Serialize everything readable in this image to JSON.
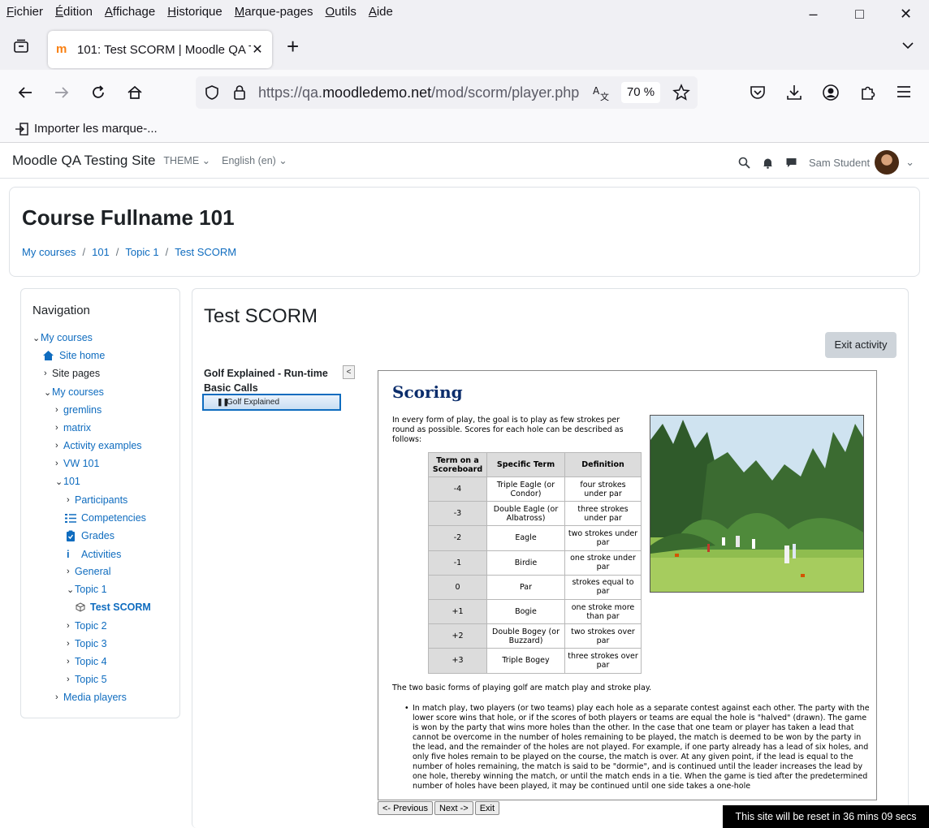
{
  "browser": {
    "menu": [
      {
        "key": "F",
        "rest": "ichier"
      },
      {
        "key": "É",
        "rest": "dition"
      },
      {
        "key": "A",
        "rest": "ffichage"
      },
      {
        "key": "H",
        "rest": "istorique"
      },
      {
        "key": "M",
        "rest": "arque-pages"
      },
      {
        "key": "O",
        "rest": "utils"
      },
      {
        "key": "A",
        "rest": "ide"
      }
    ],
    "tab_title": "101: Test SCORM | Moodle QA Testing Site",
    "url_prefix": "https://qa.",
    "url_domain": "moodledemo.net",
    "url_path": "/mod/scorm/player.php",
    "zoom": "70 %",
    "bookmark_import": "Importer les marque-..."
  },
  "moodle": {
    "site_name": "Moodle QA Testing Site",
    "theme_menu": "THEME",
    "lang_menu": "English (en)",
    "user_name": "Sam Student",
    "course_title": "Course Fullname 101",
    "breadcrumb": [
      "My courses",
      "101",
      "Topic 1",
      "Test SCORM"
    ],
    "nav_title": "Navigation",
    "nav": {
      "my_courses_top": "My courses",
      "site_home": "Site home",
      "site_pages": "Site pages",
      "my_courses": "My courses",
      "gremlins": "gremlins",
      "matrix": "matrix",
      "activity_examples": "Activity examples",
      "vw101": "VW 101",
      "c101": "101",
      "participants": "Participants",
      "competencies": "Competencies",
      "grades": "Grades",
      "activities": "Activities",
      "general": "General",
      "topic1": "Topic 1",
      "test_scorm": "Test SCORM",
      "topic2": "Topic 2",
      "topic3": "Topic 3",
      "topic4": "Topic 4",
      "topic5": "Topic 5",
      "media_players": "Media players"
    },
    "page_heading": "Test SCORM",
    "exit_activity": "Exit activity",
    "toc_title": "Golf Explained - Run-time Basic Calls",
    "toc_toggle": "<",
    "toc_item": "Golf Explained",
    "reset_notice": "This site will be reset in 36 mins 09 secs"
  },
  "scorm": {
    "heading": "Scoring",
    "intro": "In every form of play, the goal is to play as few strokes per round as possible. Scores for each hole can be described as follows:",
    "table_headers": [
      "Term on a Scoreboard",
      "Specific Term",
      "Definition"
    ],
    "table_rows": [
      [
        "-4",
        "Triple Eagle (or Condor)",
        "four strokes under par"
      ],
      [
        "-3",
        "Double Eagle (or Albatross)",
        "three strokes under par"
      ],
      [
        "-2",
        "Eagle",
        "two strokes under par"
      ],
      [
        "-1",
        "Birdie",
        "one stroke under par"
      ],
      [
        "0",
        "Par",
        "strokes equal to par"
      ],
      [
        "+1",
        "Bogie",
        "one stroke more than par"
      ],
      [
        "+2",
        "Double Bogey (or Buzzard)",
        "two strokes over par"
      ],
      [
        "+3",
        "Triple Bogey",
        "three strokes over par"
      ]
    ],
    "forms_text": "The two basic forms of playing golf are match play and stroke play.",
    "match_play": "In match play, two players (or two teams) play each hole as a separate contest against each other. The party with the lower score wins that hole, or if the scores of both players or teams are equal the hole is \"halved\" (drawn). The game is won by the party that wins more holes than the other. In the case that one team or player has taken a lead that cannot be overcome in the number of holes remaining to be played, the match is deemed to be won by the party in the lead, and the remainder of the holes are not played. For example, if one party already has a lead of six holes, and only five holes remain to be played on the course, the match is over. At any given point, if the lead is equal to the number of holes remaining, the match is said to be \"dormie\", and is continued until the leader increases the lead by one hole, thereby winning the match, or until the match ends in a tie. When the game is tied after the predetermined number of holes have been played, it may be continued until one side takes a one-hole",
    "nav_prev": "<- Previous",
    "nav_next": "Next ->",
    "nav_exit": "Exit"
  }
}
